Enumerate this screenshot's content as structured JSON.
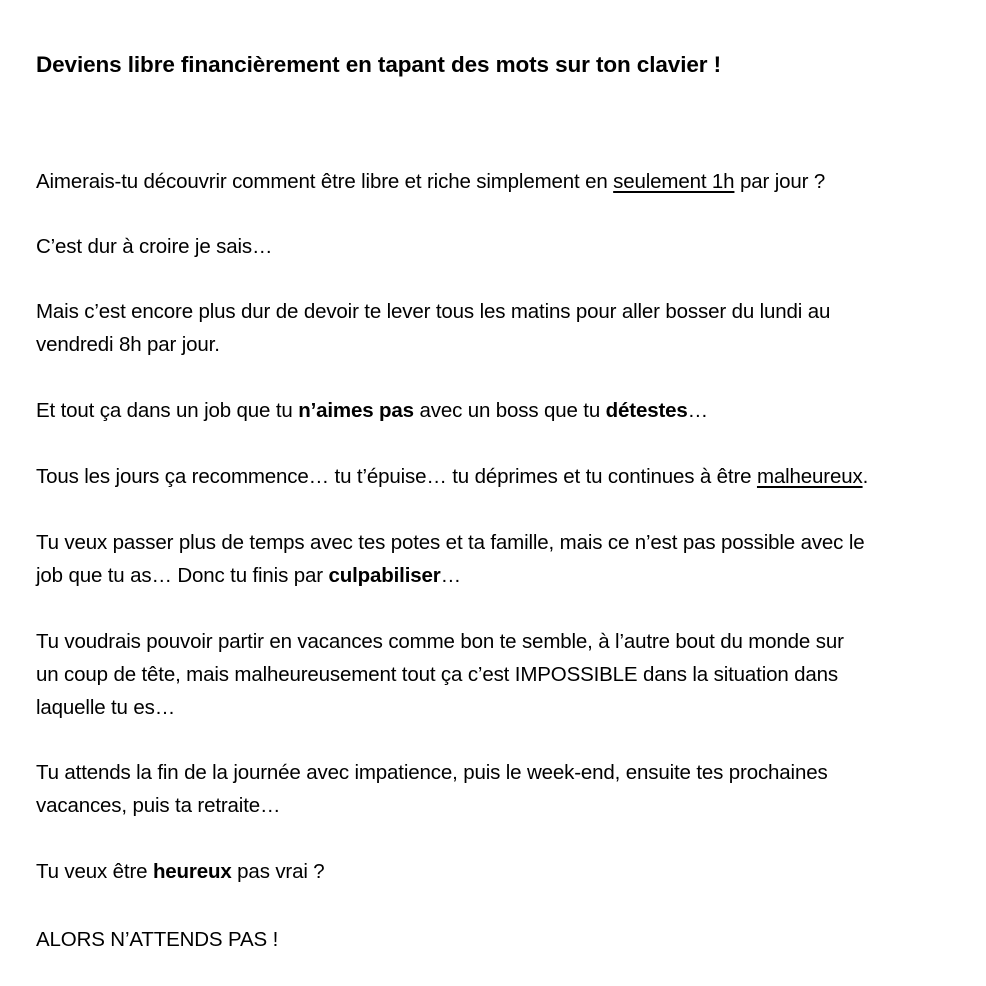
{
  "document": {
    "title": "Deviens libre financièrement en tapant des mots sur ton clavier !",
    "p1": {
      "a": "Aimerais-tu découvrir comment être libre et riche simplement en ",
      "u": "seulement 1h",
      "b": " par jour ?"
    },
    "p2": "C’est dur à croire je sais…",
    "p3": {
      "line1": "Mais c’est encore plus dur de devoir te lever tous les matins pour aller bosser du lundi au",
      "line2": "vendredi 8h par jour."
    },
    "p4": {
      "a": "Et tout ça dans un job que tu ",
      "b1": "n’aimes pas",
      "c": " avec un boss que tu ",
      "b2": "détestes",
      "d": "…"
    },
    "p5": {
      "a": "Tous les jours ça recommence… tu t’épuise… tu déprimes et tu continues à être ",
      "u": "malheureux",
      "b": "."
    },
    "p6": {
      "line1": "Tu veux passer plus de temps avec tes potes et ta famille, mais ce n’est pas possible avec le",
      "line2a": "job que tu as… Donc tu finis par ",
      "line2b": "culpabiliser",
      "line2c": "…"
    },
    "p7": {
      "line1": "Tu voudrais pouvoir partir en vacances comme bon te semble, à l’autre bout du monde sur",
      "line2": "un coup de tête, mais malheureusement tout ça c’est IMPOSSIBLE dans la situation dans",
      "line3": "laquelle tu es…"
    },
    "p8": {
      "line1": "Tu attends la fin de la journée avec impatience, puis le week-end, ensuite tes prochaines",
      "line2": "vacances, puis ta retraite…"
    },
    "p9": {
      "a": "Tu veux être ",
      "b": "heureux",
      "c": " pas vrai ?"
    },
    "p10": "ALORS N’ATTENDS PAS !"
  }
}
